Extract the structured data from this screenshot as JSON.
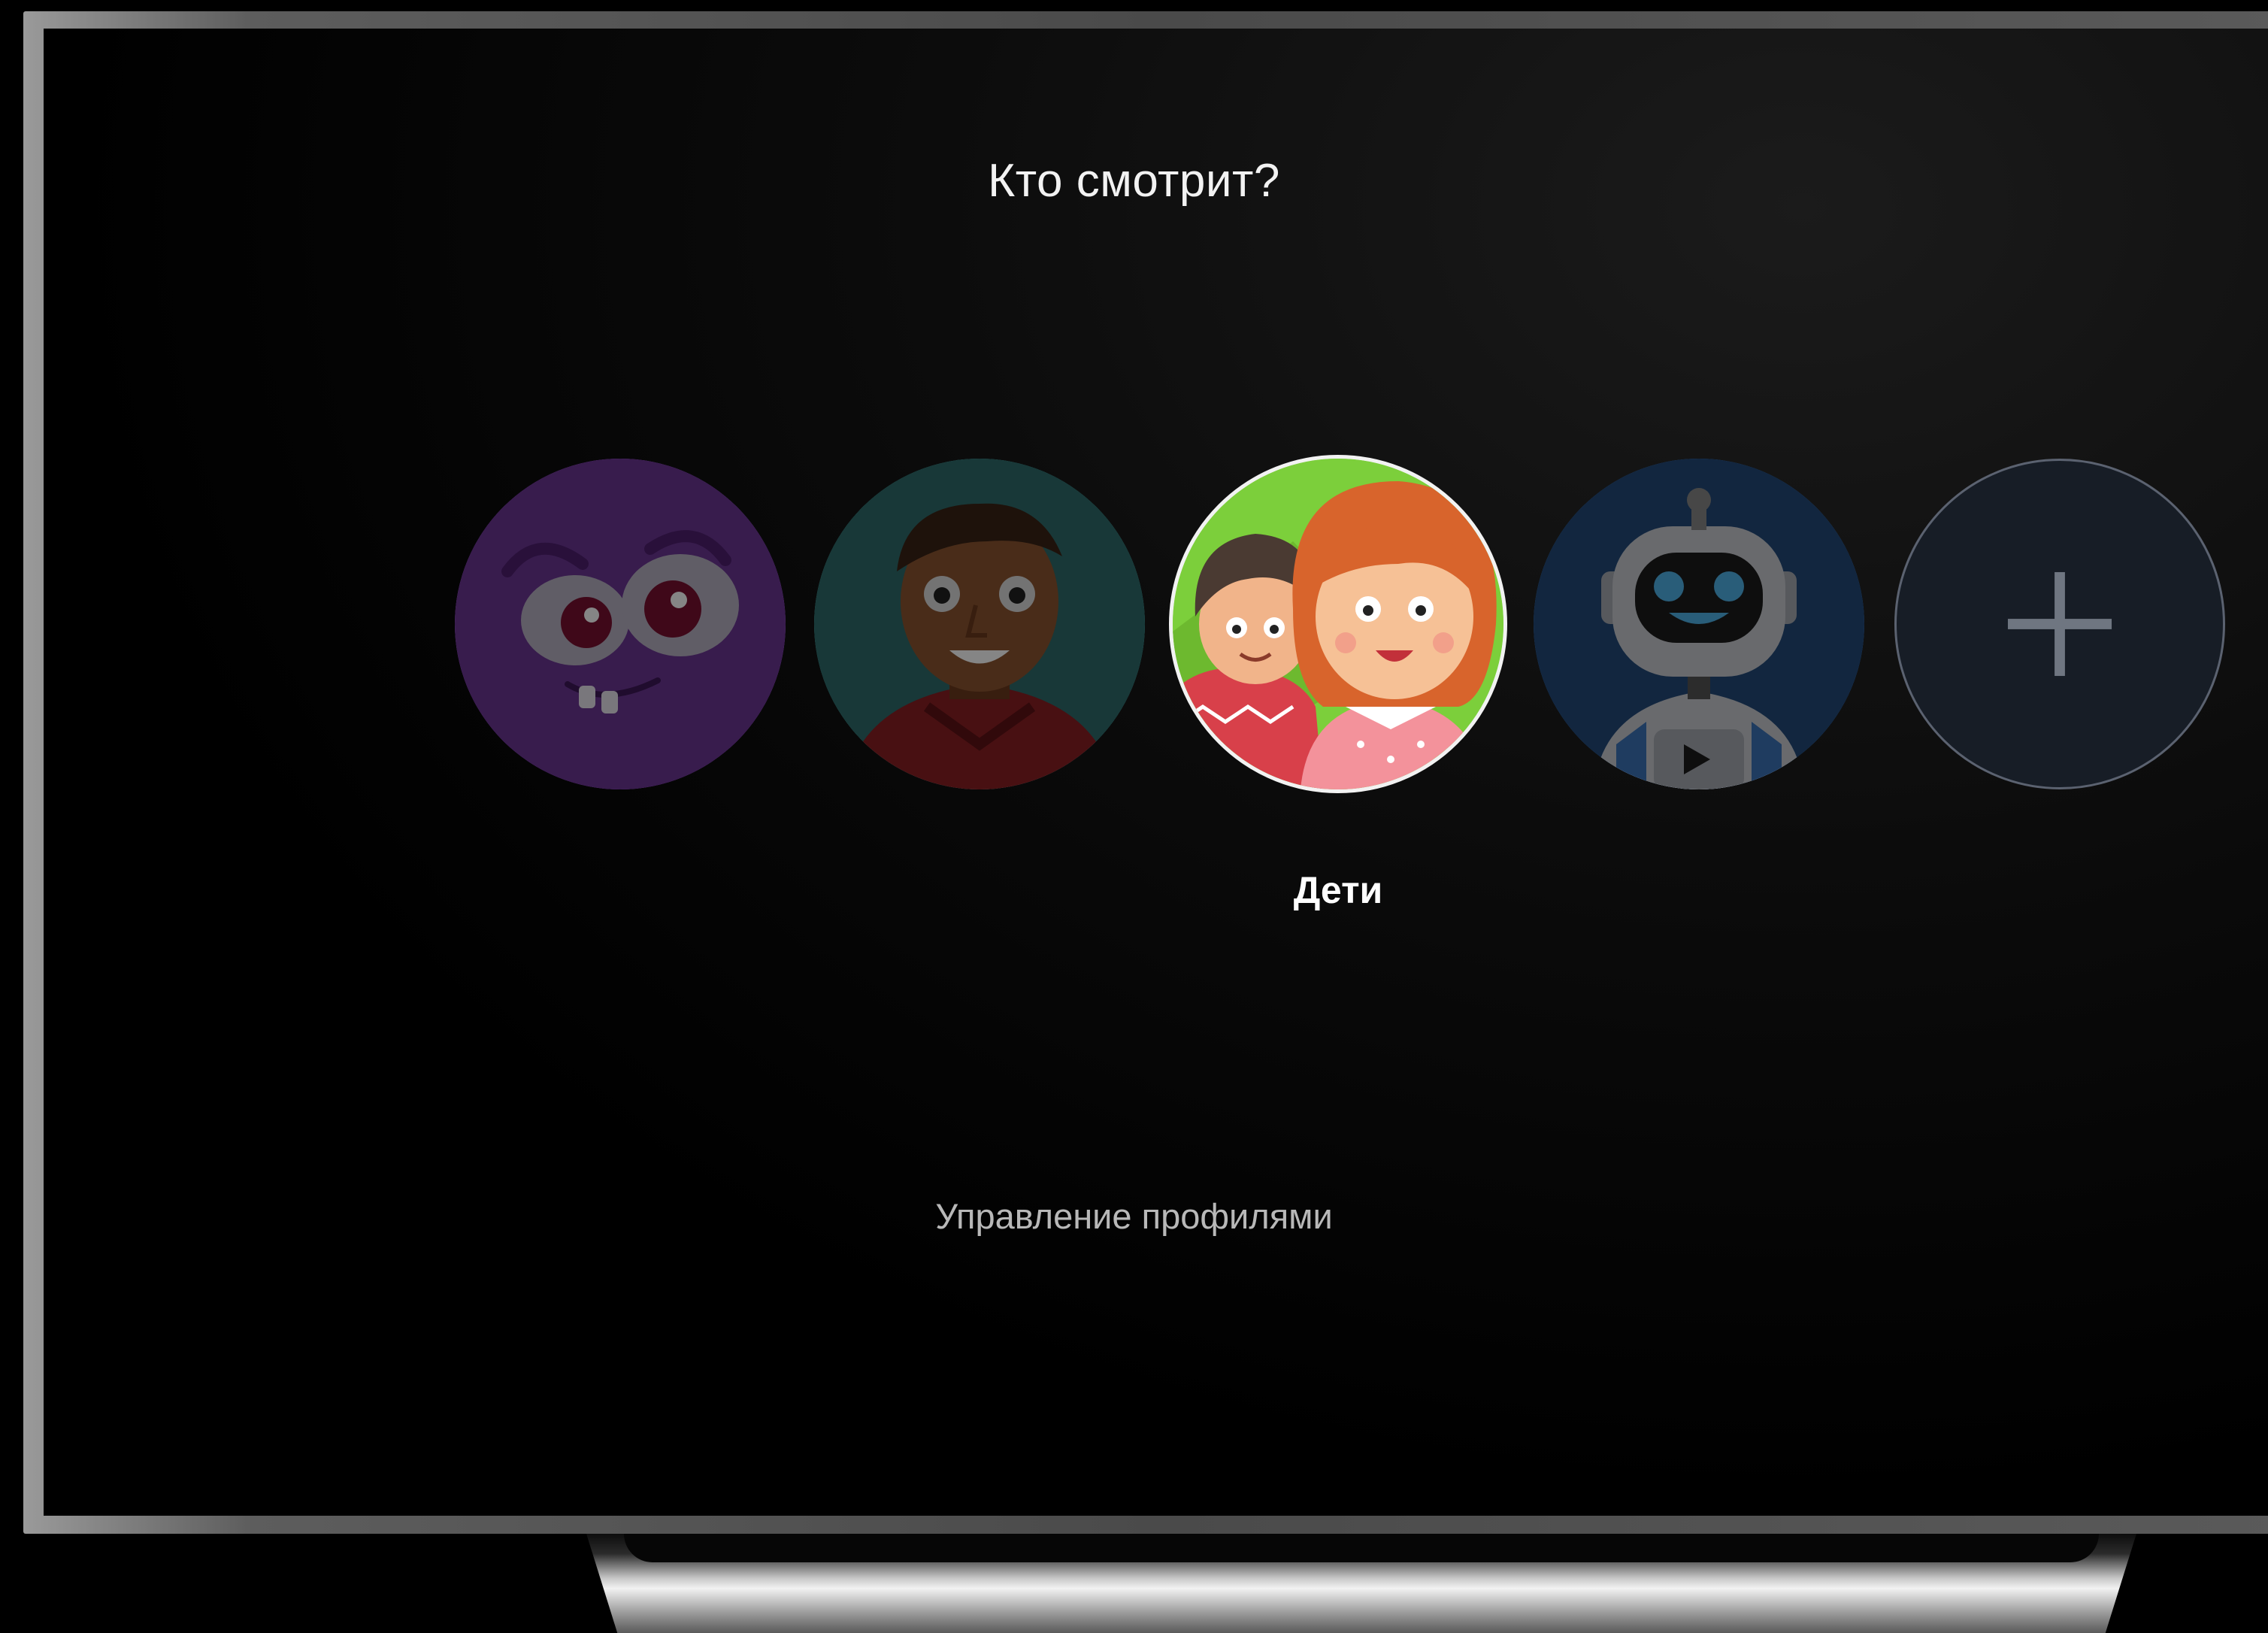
{
  "screen": {
    "title": "Кто смотрит?",
    "manage_profiles": "Управление профилями"
  },
  "profiles": [
    {
      "id": "monster",
      "avatar": "purple-monster-avatar",
      "label": "",
      "selected": false
    },
    {
      "id": "man",
      "avatar": "man-avatar",
      "label": "",
      "selected": false
    },
    {
      "id": "kids",
      "avatar": "kids-avatar",
      "label": "Дети",
      "selected": true
    },
    {
      "id": "robot",
      "avatar": "robot-avatar",
      "label": "",
      "selected": false
    },
    {
      "id": "add",
      "avatar": "plus-icon",
      "label": "",
      "selected": false
    }
  ],
  "colors": {
    "background": "#000000",
    "monster": "#6b3694",
    "man": "#2e6b6b",
    "kids": "#7ccf3b",
    "robot": "#234a7a",
    "add_button": "#171d26"
  }
}
